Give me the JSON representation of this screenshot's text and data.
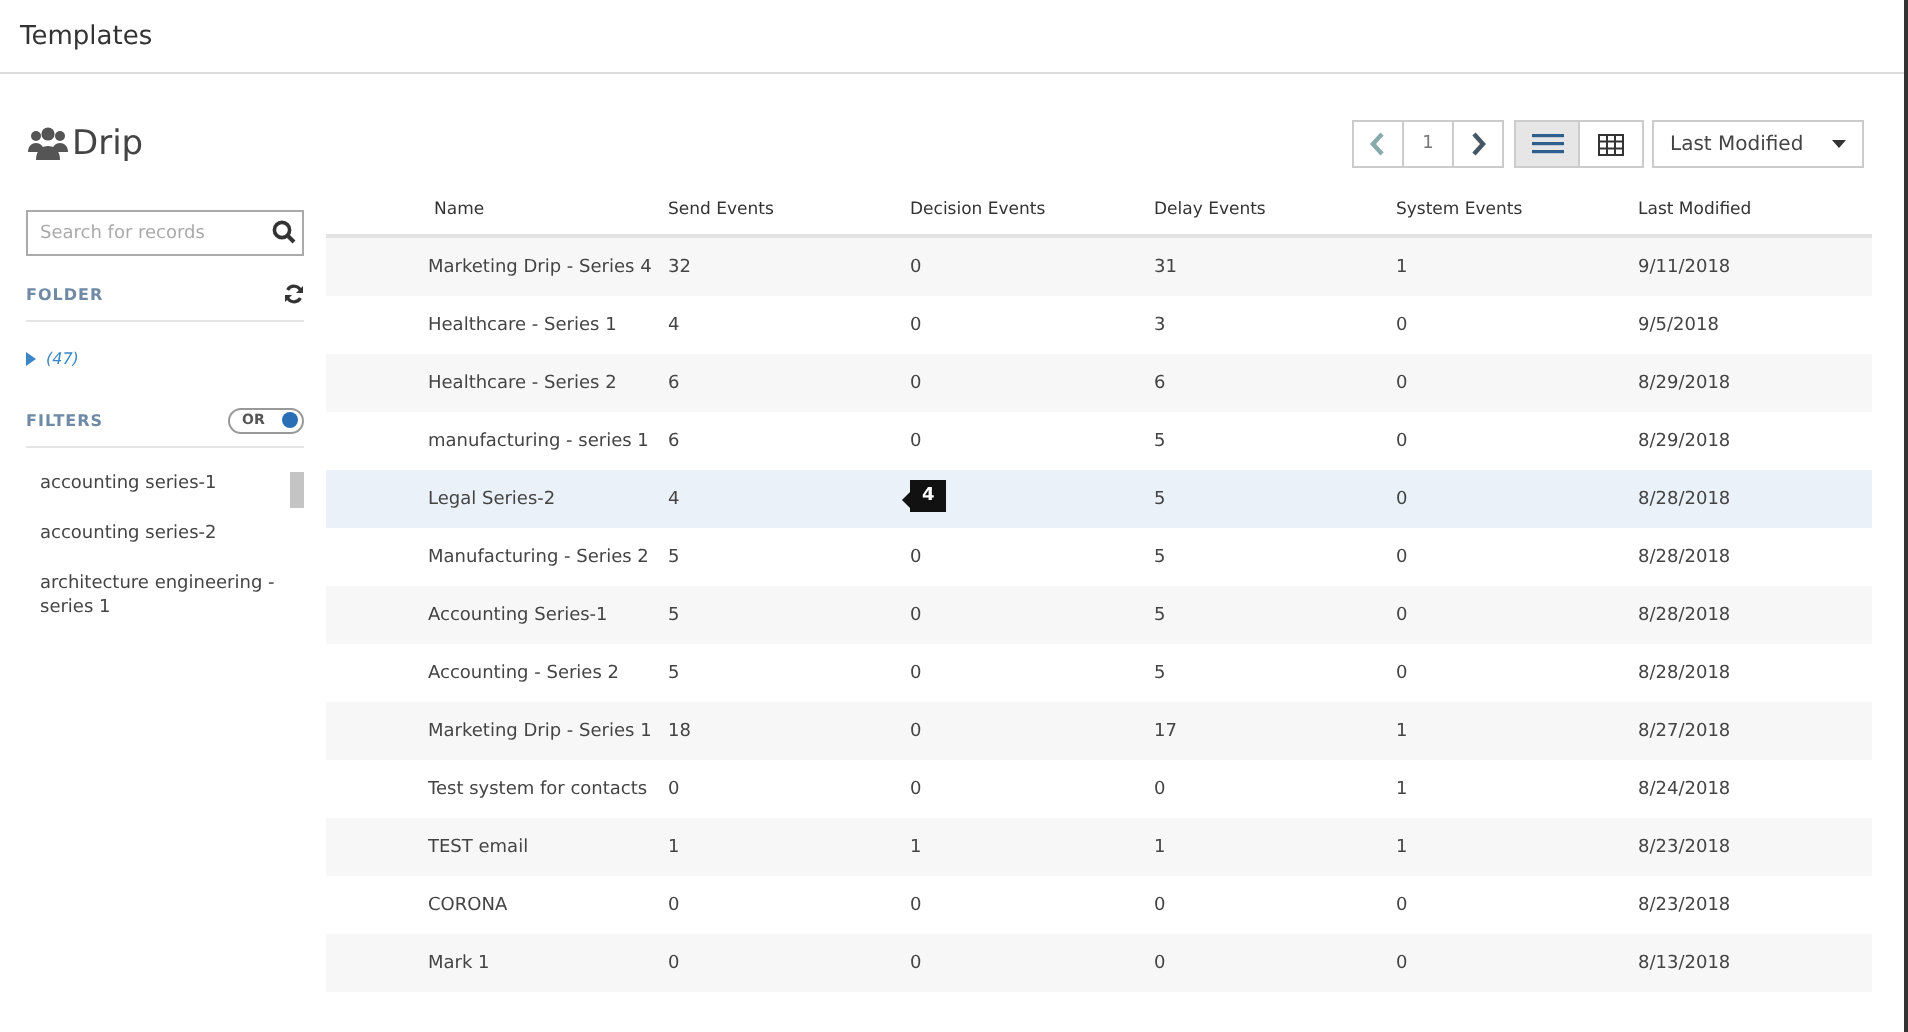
{
  "header": {
    "title": "Templates"
  },
  "page": {
    "title": "Drip"
  },
  "pager": {
    "page": "1"
  },
  "views": [
    {
      "kind": "list",
      "selected": true
    },
    {
      "kind": "grid",
      "selected": false
    }
  ],
  "sort": {
    "value": "Last Modified"
  },
  "search": {
    "placeholder": "Search for records"
  },
  "folder": {
    "label": "FOLDER",
    "items": [
      {
        "label": "(47)",
        "expanded": false
      }
    ]
  },
  "filters": {
    "label": "FILTERS",
    "toggle": {
      "label": "OR",
      "on": true
    },
    "items": [
      "accounting series-1",
      "accounting series-2",
      "architecture engineering - series 1"
    ]
  },
  "table": {
    "columns": [
      "Name",
      "Send Events",
      "Decision Events",
      "Delay Events",
      "System Events",
      "Last Modified"
    ],
    "rows": [
      {
        "cells": [
          "Marketing Drip - Series 4",
          "32",
          "0",
          "31",
          "1",
          "9/11/2018"
        ],
        "selected": false
      },
      {
        "cells": [
          "Healthcare - Series 1",
          "4",
          "0",
          "3",
          "0",
          "9/5/2018"
        ],
        "selected": false
      },
      {
        "cells": [
          "Healthcare - Series 2",
          "6",
          "0",
          "6",
          "0",
          "8/29/2018"
        ],
        "selected": false
      },
      {
        "cells": [
          "manufacturing - series 1",
          "6",
          "0",
          "5",
          "0",
          "8/29/2018"
        ],
        "selected": false
      },
      {
        "cells": [
          "Legal Series-2",
          "4",
          null,
          "5",
          "0",
          "8/28/2018"
        ],
        "selected": true,
        "tooltip": "4"
      },
      {
        "cells": [
          "Manufacturing - Series 2",
          "5",
          "0",
          "5",
          "0",
          "8/28/2018"
        ],
        "selected": false
      },
      {
        "cells": [
          "Accounting Series-1",
          "5",
          "0",
          "5",
          "0",
          "8/28/2018"
        ],
        "selected": false
      },
      {
        "cells": [
          "Accounting - Series 2",
          "5",
          "0",
          "5",
          "0",
          "8/28/2018"
        ],
        "selected": false
      },
      {
        "cells": [
          "Marketing Drip - Series 1",
          "18",
          "0",
          "17",
          "1",
          "8/27/2018"
        ],
        "selected": false
      },
      {
        "cells": [
          "Test system for contacts",
          "0",
          "0",
          "0",
          "1",
          "8/24/2018"
        ],
        "selected": false
      },
      {
        "cells": [
          "TEST email",
          "1",
          "1",
          "1",
          "1",
          "8/23/2018"
        ],
        "selected": false
      },
      {
        "cells": [
          "CORONA",
          "0",
          "0",
          "0",
          "0",
          "8/23/2018"
        ],
        "selected": false
      },
      {
        "cells": [
          "Mark 1",
          "0",
          "0",
          "0",
          "0",
          "8/13/2018"
        ],
        "selected": false
      }
    ]
  }
}
